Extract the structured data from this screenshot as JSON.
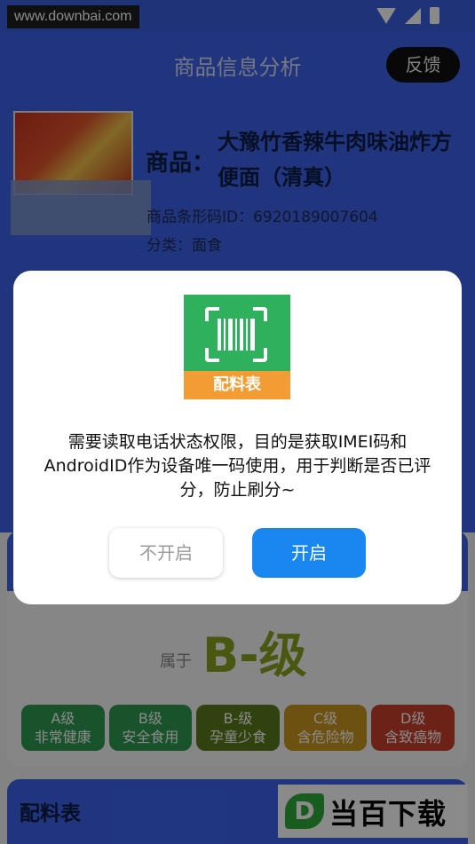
{
  "status_bar": {
    "watermark": "www.downbai.com",
    "icons": [
      "wifi-icon",
      "signal-icon",
      "battery-icon"
    ]
  },
  "header": {
    "title": "商品信息分析",
    "feedback_label": "反馈"
  },
  "product": {
    "label": "商品：",
    "name": "大豫竹香辣牛肉味油炸方便面（清真）",
    "barcode_label": "商品条形码ID：",
    "barcode": "6920189007604",
    "category_label": "分类：",
    "category": "面食"
  },
  "grade": {
    "belongs_label": "属于",
    "value": "B-级",
    "levels": [
      {
        "grade": "A级",
        "desc": "非常健康",
        "color": "#2f9a52"
      },
      {
        "grade": "B级",
        "desc": "安全食用",
        "color": "#2f9a52"
      },
      {
        "grade": "B-级",
        "desc": "孕童少食",
        "color": "#5a7a1a"
      },
      {
        "grade": "C级",
        "desc": "含危险物",
        "color": "#c9971f"
      },
      {
        "grade": "D级",
        "desc": "含致癌物",
        "color": "#c8402c"
      }
    ]
  },
  "ingredients": {
    "title": "配料表"
  },
  "brand_watermark": {
    "logo_letter": "D",
    "text": "当百下载"
  },
  "dialog": {
    "app_icon_label": "配料表",
    "message": "需要读取电话状态权限，目的是获取IMEI码和AndroidID作为设备唯一码使用，用于判断是否已评分，防止刷分~",
    "cancel_label": "不开启",
    "confirm_label": "开启"
  },
  "colors": {
    "primary": "#3b63e8",
    "confirm_button": "#1a87f0",
    "icon_green": "#2fb05c",
    "icon_orange": "#f39c34",
    "grade_highlight": "#8aa21f"
  }
}
